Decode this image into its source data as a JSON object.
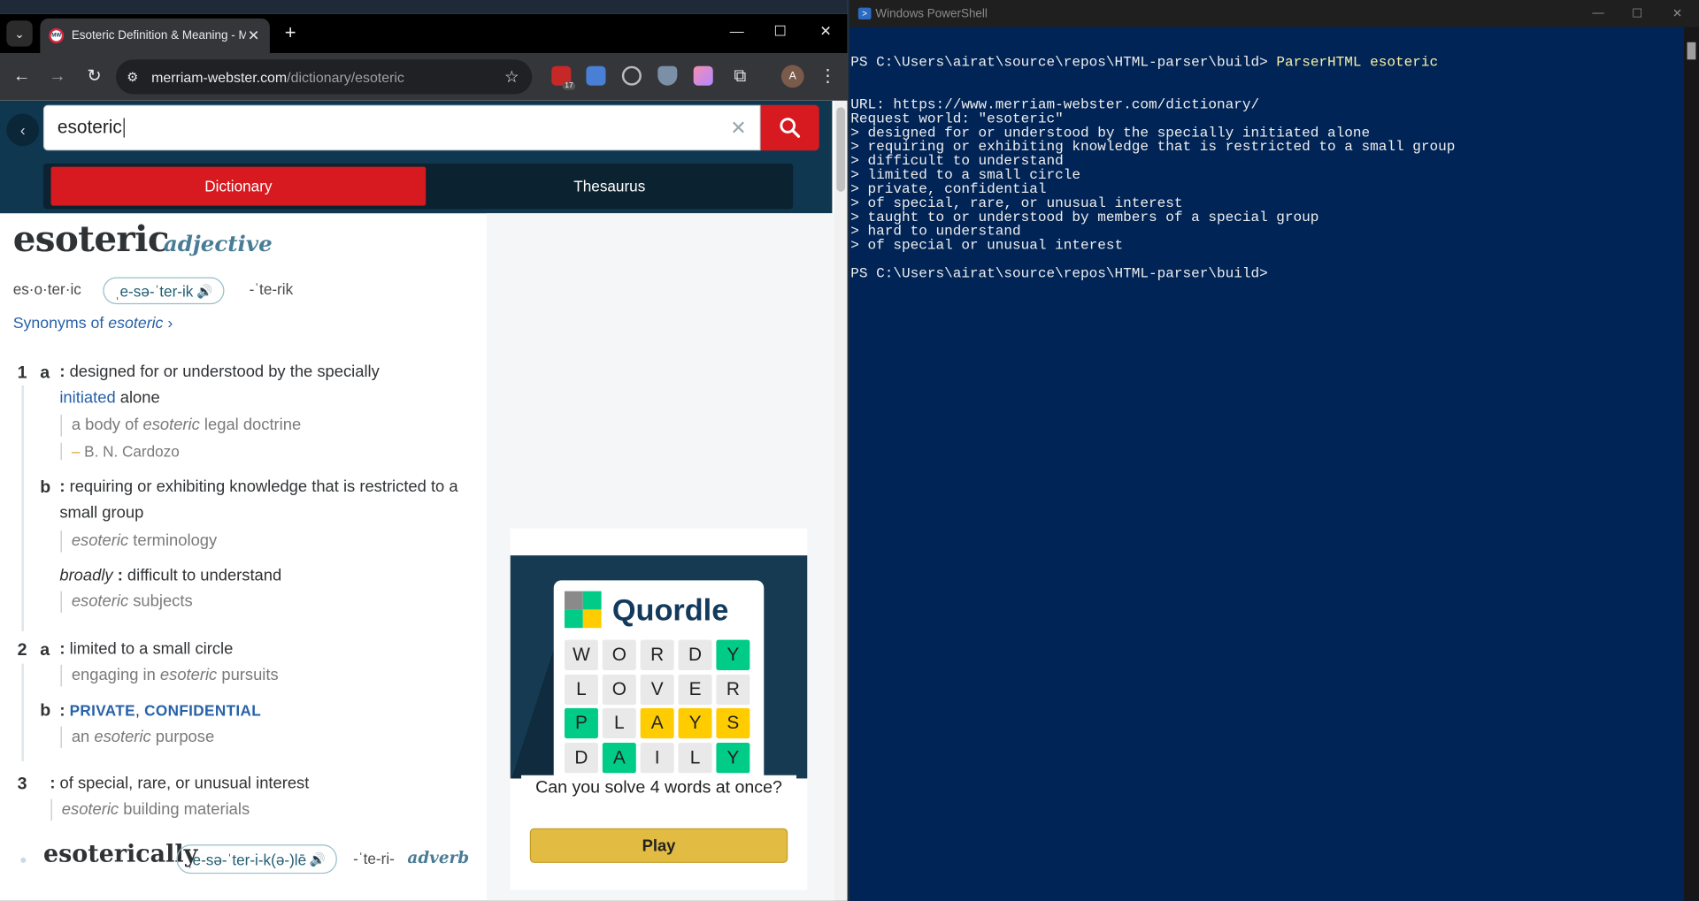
{
  "browser": {
    "tab_title": "Esoteric Definition & Meaning - M",
    "tab_close": "✕",
    "new_tab": "+",
    "url_host": "merriam-webster.com",
    "url_path": "/dictionary/esoteric",
    "ext_badge": "17",
    "avatar_letter": "A",
    "favicon_text": "MW"
  },
  "page": {
    "search_value": "esoteric",
    "tabs": {
      "dictionary": "Dictionary",
      "thesaurus": "Thesaurus"
    },
    "headword": "esoteric",
    "part_of_speech": "adjective",
    "syllables": "es·o·ter·ic",
    "pronunciation": "ˌe-sə-ˈter-ik",
    "pronunciation_alt": "-ˈte-rik",
    "synonyms_prefix": "Synonyms of ",
    "synonyms_word": "esoteric",
    "senses": {
      "s1_num": "1",
      "s1a_letter": "a",
      "s1a_text1": "designed for or understood by the specially",
      "s1a_link": "initiated",
      "s1a_text2": "alone",
      "s1a_ex_pre": "a body of ",
      "s1a_ex_it": "esoteric",
      "s1a_ex_post": " legal doctrine",
      "s1a_attr": "B. N. Cardozo",
      "s1b_letter": "b",
      "s1b_text": "requiring or exhibiting knowledge that is restricted to a small group",
      "s1b_ex_it": "esoteric",
      "s1b_ex_post": " terminology",
      "s1b_broadly": "broadly",
      "s1b_broadly_text": "difficult to understand",
      "s1b_ex2_it": "esoteric",
      "s1b_ex2_post": " subjects",
      "s2_num": "2",
      "s2a_letter": "a",
      "s2a_text": "limited to a small circle",
      "s2a_ex_pre": "engaging in ",
      "s2a_ex_it": "esoteric",
      "s2a_ex_post": " pursuits",
      "s2b_letter": "b",
      "s2b_link1": "PRIVATE",
      "s2b_sep": ", ",
      "s2b_link2": "CONFIDENTIAL",
      "s2b_ex_pre": "an ",
      "s2b_ex_it": "esoteric",
      "s2b_ex_post": " purpose",
      "s3_num": "3",
      "s3_text": "of special, rare, or unusual interest",
      "s3_ex_it": "esoteric",
      "s3_ex_post": " building materials"
    },
    "runon": {
      "word": "esoterically",
      "pronunciation": "ˌe-sə-ˈter-i-k(ə-)lē",
      "alt": "-ˈte-ri-",
      "pos": "adverb"
    },
    "ad": {
      "brand": "Quordle",
      "grid": [
        [
          "W",
          "O",
          "R",
          "D",
          "Y"
        ],
        [
          "L",
          "O",
          "V",
          "E",
          "R"
        ],
        [
          "P",
          "L",
          "A",
          "Y",
          "S"
        ],
        [
          "D",
          "A",
          "I",
          "L",
          "Y"
        ]
      ],
      "grid_colors": [
        [
          "g",
          "g",
          "g",
          "g",
          "G"
        ],
        [
          "g",
          "g",
          "g",
          "g",
          "g"
        ],
        [
          "G",
          "g",
          "Y",
          "Y",
          "Y"
        ],
        [
          "g",
          "G",
          "g",
          "g",
          "G"
        ]
      ],
      "tagline": "Can you solve 4 words at once?",
      "play": "Play"
    }
  },
  "powershell": {
    "title": "Windows PowerShell",
    "prompt1": "PS C:\\Users\\airat\\source\\repos\\HTML-parser\\build> ",
    "command": "ParserHTML esoteric",
    "lines": [
      "URL: https://www.merriam-webster.com/dictionary/",
      "Request world: \"esoteric\"",
      "> designed for or understood by the specially initiated alone",
      "> requiring or exhibiting knowledge that is restricted to a small group",
      "> difficult to understand",
      "> limited to a small circle",
      "> private, confidential",
      "> of special, rare, or unusual interest",
      "> taught to or understood by members of a special group",
      "> hard to understand",
      "> of special or unusual interest",
      "",
      "PS C:\\Users\\airat\\source\\repos\\HTML-parser\\build>"
    ]
  },
  "colors": {
    "mw_red": "#d71920",
    "mw_navy": "#0f3850",
    "ps_bg": "#012456",
    "quordle_green": "#00cc88",
    "quordle_yellow": "#ffcc00"
  }
}
